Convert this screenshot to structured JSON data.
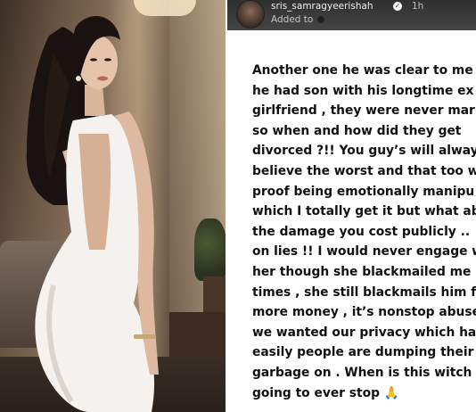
{
  "story": {
    "username": "sris_samragyeerishah",
    "verified_icon": "verified-check-icon",
    "time": "1h",
    "added_to": "Added to",
    "text_lines": [
      "Another one he was clear to me",
      "he had son with his longtime ex",
      "girlfriend , they were never marr",
      "so when and how did they get",
      "divorced ?!! You guy’s will alway",
      "believe the worst and that too w",
      "proof being emotionally manipu",
      "which I totally get it but what ab",
      "the damage you cost publicly ..",
      "on lies !! I would never engage w",
      "her though she blackmailed me",
      "times , she still blackmails him f",
      "more money , it’s nonstop abuse",
      "we wanted our privacy which ha",
      "easily people are dumping their",
      "garbage on . When is this witch",
      "going to ever stop 🙏"
    ]
  },
  "photo": {
    "subject": "woman-in-white-dress-photo"
  },
  "colors": {
    "story_text": "#111111",
    "header_bg": "#3a3a3a",
    "dress": "#f4f1ee",
    "hair": "#1a1210"
  }
}
